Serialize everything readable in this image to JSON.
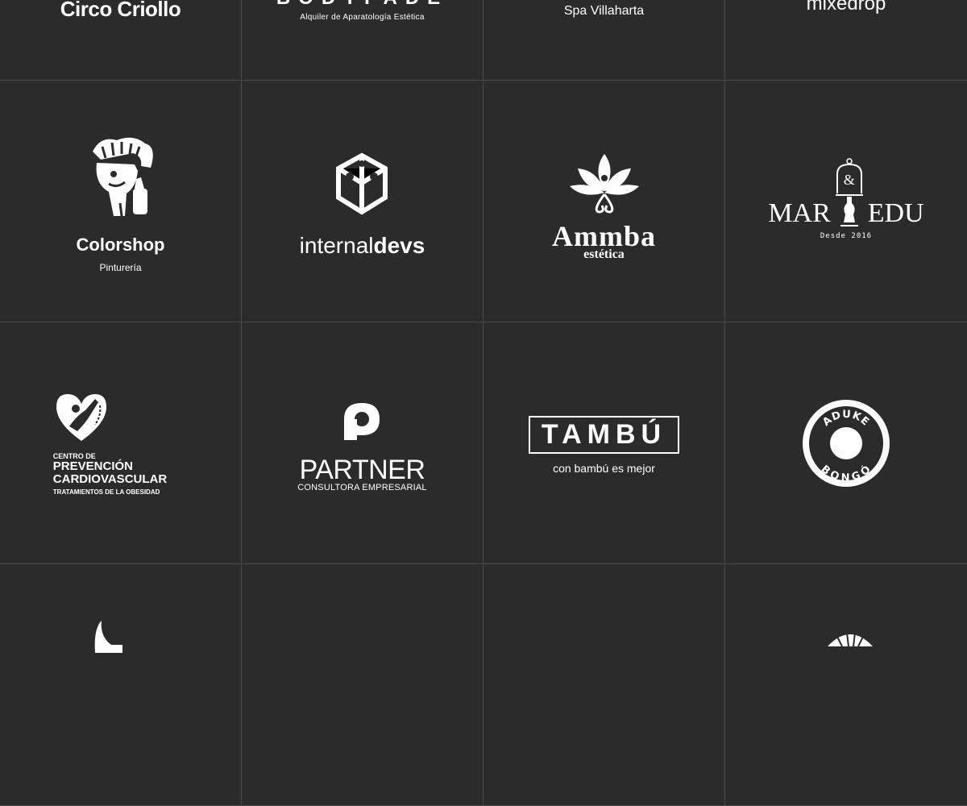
{
  "logos": {
    "circo_criollo": {
      "name": "Circo Criollo"
    },
    "bodyfade": {
      "name": "BODYFADE",
      "tagline": "Alquiler de Aparatología Estética"
    },
    "spa": {
      "name": "Spa Villaharta"
    },
    "mixedrop": {
      "name": "mixedrop"
    },
    "colorshop": {
      "name": "Colorshop",
      "tagline": "Pinturería"
    },
    "internaldevs": {
      "prefix": "internal",
      "suffix": "devs"
    },
    "ammba": {
      "name": "Ammba",
      "tagline": "estética"
    },
    "maredu": {
      "left": "MAR",
      "amp": "&",
      "right": "EDU",
      "tagline": "Desde 2016"
    },
    "cardio": {
      "line1": "CENTRO DE",
      "line2": "PREVENCIÓN",
      "line3": "CARDIOVASCULAR",
      "line4": "TRATAMIENTOS DE LA OBESIDAD"
    },
    "partner": {
      "name": "PARTNER",
      "tagline": "CONSULTORA EMPRESARIAL"
    },
    "tambu": {
      "name": "TAMBÚ",
      "tagline": "con bambú es mejor"
    },
    "bongo": {
      "top": "ADUKE",
      "bottom": "BONGÓ"
    }
  },
  "colors": {
    "background": "#2b2b2b",
    "foreground": "#ffffff",
    "divider": "#4a4a4a"
  }
}
